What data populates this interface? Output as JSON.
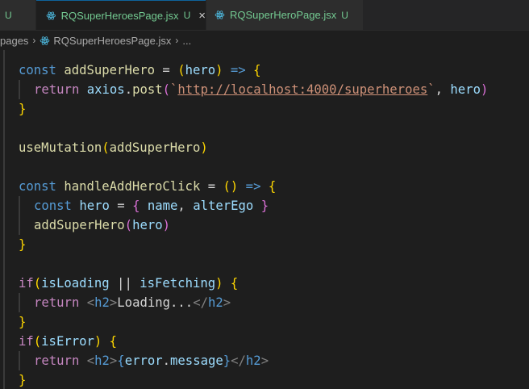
{
  "tabs": [
    {
      "label": "",
      "flag": "U",
      "close": ""
    },
    {
      "label": "RQSuperHeroesPage.jsx",
      "flag": "U",
      "close": "×"
    },
    {
      "label": "RQSuperHeroPage.jsx",
      "flag": "U",
      "close": ""
    }
  ],
  "breadcrumb": {
    "folder": "pages",
    "file": "RQSuperHeroesPage.jsx",
    "more": "..."
  },
  "code": {
    "l1": {
      "kw": "const",
      "name": "addSuperHero",
      "eq": " = ",
      "lp": "(",
      "param": "hero",
      "rp": ")",
      "arrow": " => ",
      "brace": "{"
    },
    "l2": {
      "kw": "return",
      "obj": "axios",
      "dot": ".",
      "fn": "post",
      "lp": "(",
      "tick1": "`",
      "url": "http://localhost:4000/superheroes",
      "tick2": "`",
      "comma": ", ",
      "arg": "hero",
      "rp": ")"
    },
    "l3": {
      "brace": "}"
    },
    "l5": {
      "fn": "useMutation",
      "lp": "(",
      "arg": "addSuperHero",
      "rp": ")"
    },
    "l7": {
      "kw": "const",
      "name": "handleAddHeroClick",
      "eq": " = ",
      "lp": "(",
      "rp": ")",
      "arrow": " => ",
      "brace": "{"
    },
    "l8": {
      "kw": "const",
      "name": "hero",
      "eq": " = ",
      "lb": "{",
      "a": " name",
      "comma": ",",
      "b": " alterEgo",
      "rb": " }"
    },
    "l9": {
      "fn": "addSuperHero",
      "lp": "(",
      "arg": "hero",
      "rp": ")"
    },
    "l10": {
      "brace": "}"
    },
    "l12": {
      "kw": "if",
      "lp": "(",
      "a": "isLoading",
      "op": " || ",
      "b": "isFetching",
      "rp": ")",
      "brace": " {"
    },
    "l13": {
      "kw": "return",
      "open": "<",
      "tag": "h2",
      "close": ">",
      "text": "Loading...",
      "open2": "</",
      "tag2": "h2",
      "close2": ">"
    },
    "l14": {
      "brace": "}"
    },
    "l15": {
      "kw": "if",
      "lp": "(",
      "a": "isError",
      "rp": ")",
      "brace": " {"
    },
    "l16": {
      "kw": "return",
      "open": "<",
      "tag": "h2",
      "close": ">",
      "lb": "{",
      "obj": "error",
      "dot": ".",
      "prop": "message",
      "rb": "}",
      "open2": "</",
      "tag2": "h2",
      "close2": ">"
    },
    "l17": {
      "brace": "}"
    }
  },
  "colors": {
    "editor_bg": "#1e1e1e",
    "keyword": "#569cd6",
    "control": "#c586c0",
    "function": "#dcdcaa",
    "variable": "#9cdcfe",
    "string": "#ce9178",
    "untracked": "#73c991"
  },
  "icons": [
    "react-icon"
  ]
}
